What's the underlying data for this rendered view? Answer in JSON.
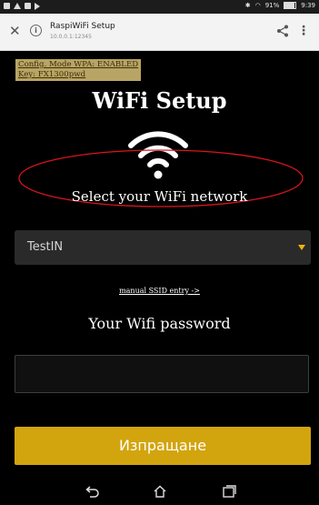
{
  "status_bar": {
    "time": "9:39",
    "battery": "91%"
  },
  "browser": {
    "page_title": "RaspiWiFi Setup",
    "url": "10.0.0.1:12345",
    "close_icon": "close-icon",
    "info_icon": "info-icon",
    "share_icon": "share-icon",
    "menu_icon": "more-vert-icon"
  },
  "page": {
    "config_note": [
      "Config. Mode WPA: ENABLED",
      "Key: FX1300pwd"
    ],
    "title": "WiFi Setup",
    "wifi_icon": "wifi-icon",
    "select_label": "Select your WiFi network",
    "network_select": {
      "value": "TestIN",
      "arrow_icon": "dropdown-arrow-icon"
    },
    "manual_link": "manual SSID entry ->",
    "password_label": "Your Wifi password",
    "password_field": {
      "value": ""
    },
    "submit_label": "Изпращане"
  },
  "annotation": {
    "shape": "ellipse",
    "color": "#d9141c"
  },
  "colors": {
    "page_bg": "#000000",
    "button_bg": "#d2a40e",
    "select_arrow": "#f0b30c",
    "config_note_bg": "#b8a464"
  },
  "nav_bar": {
    "back_icon": "back-icon",
    "home_icon": "home-icon",
    "recents_icon": "recents-icon"
  }
}
